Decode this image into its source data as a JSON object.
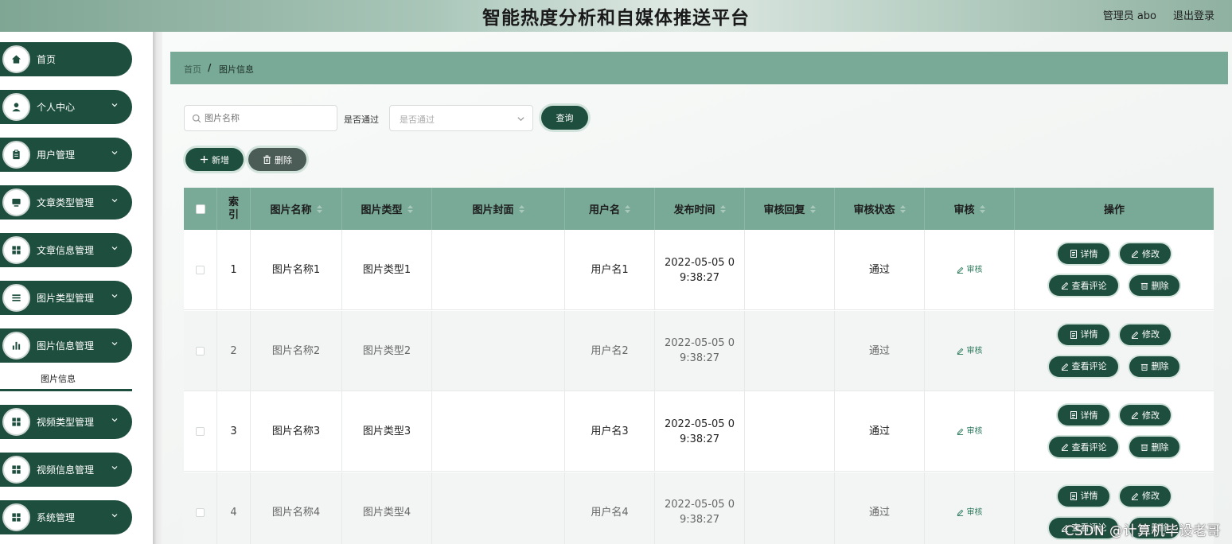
{
  "header": {
    "title": "智能热度分析和自媒体推送平台",
    "admin": "管理员 abo",
    "logout": "退出登录"
  },
  "sidebar": {
    "items": [
      {
        "label": "首页",
        "icon": "home-icon"
      },
      {
        "label": "个人中心",
        "icon": "user-icon"
      },
      {
        "label": "用户管理",
        "icon": "clipboard-icon"
      },
      {
        "label": "文章类型管理",
        "icon": "monitor-icon"
      },
      {
        "label": "文章信息管理",
        "icon": "grid-icon"
      },
      {
        "label": "图片类型管理",
        "icon": "list-icon"
      },
      {
        "label": "图片信息管理",
        "icon": "bar-chart-icon"
      },
      {
        "label": "视频类型管理",
        "icon": "grid-icon"
      },
      {
        "label": "视频信息管理",
        "icon": "grid-icon"
      },
      {
        "label": "系统管理",
        "icon": "grid-icon"
      }
    ],
    "submenu_label": "图片信息"
  },
  "breadcrumb": {
    "home": "首页",
    "separator": "/",
    "current": "图片信息"
  },
  "search": {
    "name_placeholder": "图片名称",
    "passed_label": "是否通过",
    "passed_placeholder": "是否通过",
    "query_button": "查询"
  },
  "actions": {
    "add_button": "新增",
    "delete_button": "删除"
  },
  "table": {
    "headers": {
      "index": "索引",
      "name": "图片名称",
      "type": "图片类型",
      "cover": "图片封面",
      "username": "用户名",
      "publish_time": "发布时间",
      "review_reply": "审核回复",
      "review_status": "审核状态",
      "review": "审核",
      "operation": "操作"
    },
    "rows": [
      {
        "index": "1",
        "name": "图片名称1",
        "type": "图片类型1",
        "username": "用户名1",
        "publish_time": "2022-05-05 09:38:27",
        "status": "通过"
      },
      {
        "index": "2",
        "name": "图片名称2",
        "type": "图片类型2",
        "username": "用户名2",
        "publish_time": "2022-05-05 09:38:27",
        "status": "通过"
      },
      {
        "index": "3",
        "name": "图片名称3",
        "type": "图片类型3",
        "username": "用户名3",
        "publish_time": "2022-05-05 09:38:27",
        "status": "通过"
      },
      {
        "index": "4",
        "name": "图片名称4",
        "type": "图片类型4",
        "username": "用户名4",
        "publish_time": "2022-05-05 09:38:27",
        "status": "通过"
      }
    ],
    "row_actions": {
      "detail": "详情",
      "edit": "修改",
      "view_comments": "查看评论",
      "delete": "删除",
      "audit": "审核"
    }
  },
  "watermark": "CSDN @计算机毕设老哥",
  "colors": {
    "primary": "#1e4e3d",
    "header_bg": "#79a997",
    "link": "#2c7a5c"
  }
}
